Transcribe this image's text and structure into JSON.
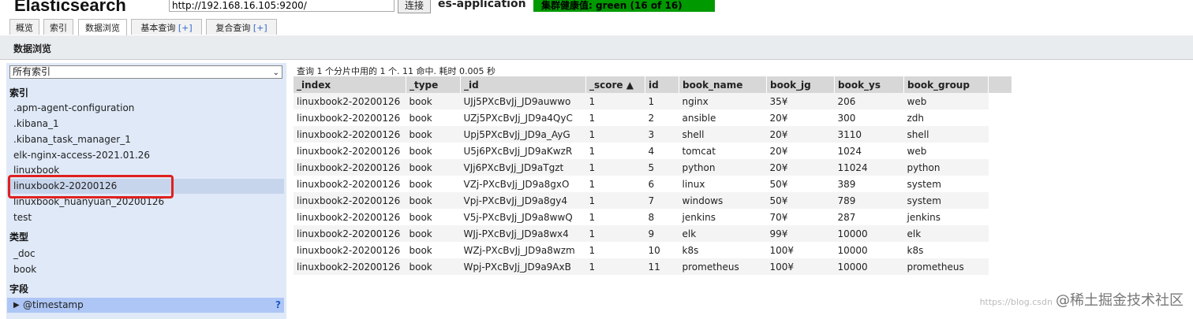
{
  "header": {
    "brand": "Elasticsearch",
    "url": "http://192.168.16.105:9200/",
    "connect_label": "连接",
    "cluster_name": "es-application",
    "health": "集群健康值: green (16 of 16)"
  },
  "tabs": [
    {
      "label": "概览",
      "plus": ""
    },
    {
      "label": "索引",
      "plus": ""
    },
    {
      "label": "数据浏览",
      "plus": ""
    },
    {
      "label": "基本查询 ",
      "plus": "[+]"
    },
    {
      "label": "复合查询 ",
      "plus": "[+]"
    }
  ],
  "section_title": "数据浏览",
  "sidebar": {
    "select_value": "所有索引",
    "index_heading": "索引",
    "indices": [
      ".apm-agent-configuration",
      ".kibana_1",
      ".kibana_task_manager_1",
      "elk-nginx-access-2021.01.26",
      "linuxbook",
      "linuxbook2-20200126",
      "linuxbook_huanyuan_20200126",
      "test"
    ],
    "type_heading": "类型",
    "types": [
      "_doc",
      "book"
    ],
    "field_heading": "字段",
    "field_item": "@timestamp",
    "field_help": "?"
  },
  "results": {
    "summary": "查询 1 个分片中用的 1 个. 11 命中. 耗时 0.005 秒",
    "columns": [
      "_index",
      "_type",
      "_id",
      "_score ▲",
      "id",
      "book_name",
      "book_jg",
      "book_ys",
      "book_group"
    ],
    "rows": [
      [
        "linuxbook2-20200126",
        "book",
        "UJj5PXcBvJj_JD9auwwo",
        "1",
        "1",
        "nginx",
        "35¥",
        "206",
        "web"
      ],
      [
        "linuxbook2-20200126",
        "book",
        "UZj5PXcBvJj_JD9a4QyC",
        "1",
        "2",
        "ansible",
        "20¥",
        "300",
        "zdh"
      ],
      [
        "linuxbook2-20200126",
        "book",
        "Upj5PXcBvJj_JD9a_AyG",
        "1",
        "3",
        "shell",
        "20¥",
        "3110",
        "shell"
      ],
      [
        "linuxbook2-20200126",
        "book",
        "U5j6PXcBvJj_JD9aKwzR",
        "1",
        "4",
        "tomcat",
        "20¥",
        "1024",
        "web"
      ],
      [
        "linuxbook2-20200126",
        "book",
        "VJj6PXcBvJj_JD9aTgzt",
        "1",
        "5",
        "python",
        "20¥",
        "11024",
        "python"
      ],
      [
        "linuxbook2-20200126",
        "book",
        "VZj-PXcBvJj_JD9a8gxO",
        "1",
        "6",
        "linux",
        "50¥",
        "389",
        "system"
      ],
      [
        "linuxbook2-20200126",
        "book",
        "Vpj-PXcBvJj_JD9a8gy4",
        "1",
        "7",
        "windows",
        "50¥",
        "789",
        "system"
      ],
      [
        "linuxbook2-20200126",
        "book",
        "V5j-PXcBvJj_JD9a8wwQ",
        "1",
        "8",
        "jenkins",
        "70¥",
        "287",
        "jenkins"
      ],
      [
        "linuxbook2-20200126",
        "book",
        "WJj-PXcBvJj_JD9a8wx4",
        "1",
        "9",
        "elk",
        "99¥",
        "10000",
        "elk"
      ],
      [
        "linuxbook2-20200126",
        "book",
        "WZj-PXcBvJj_JD9a8wzm",
        "1",
        "10",
        "k8s",
        "100¥",
        "10000",
        "k8s"
      ],
      [
        "linuxbook2-20200126",
        "book",
        "Wpj-PXcBvJj_JD9a9AxB",
        "1",
        "11",
        "prometheus",
        "100¥",
        "10000",
        "prometheus"
      ]
    ]
  },
  "watermark": {
    "url": "https://blog.csdn",
    "text": "@稀土掘金技术社区"
  }
}
